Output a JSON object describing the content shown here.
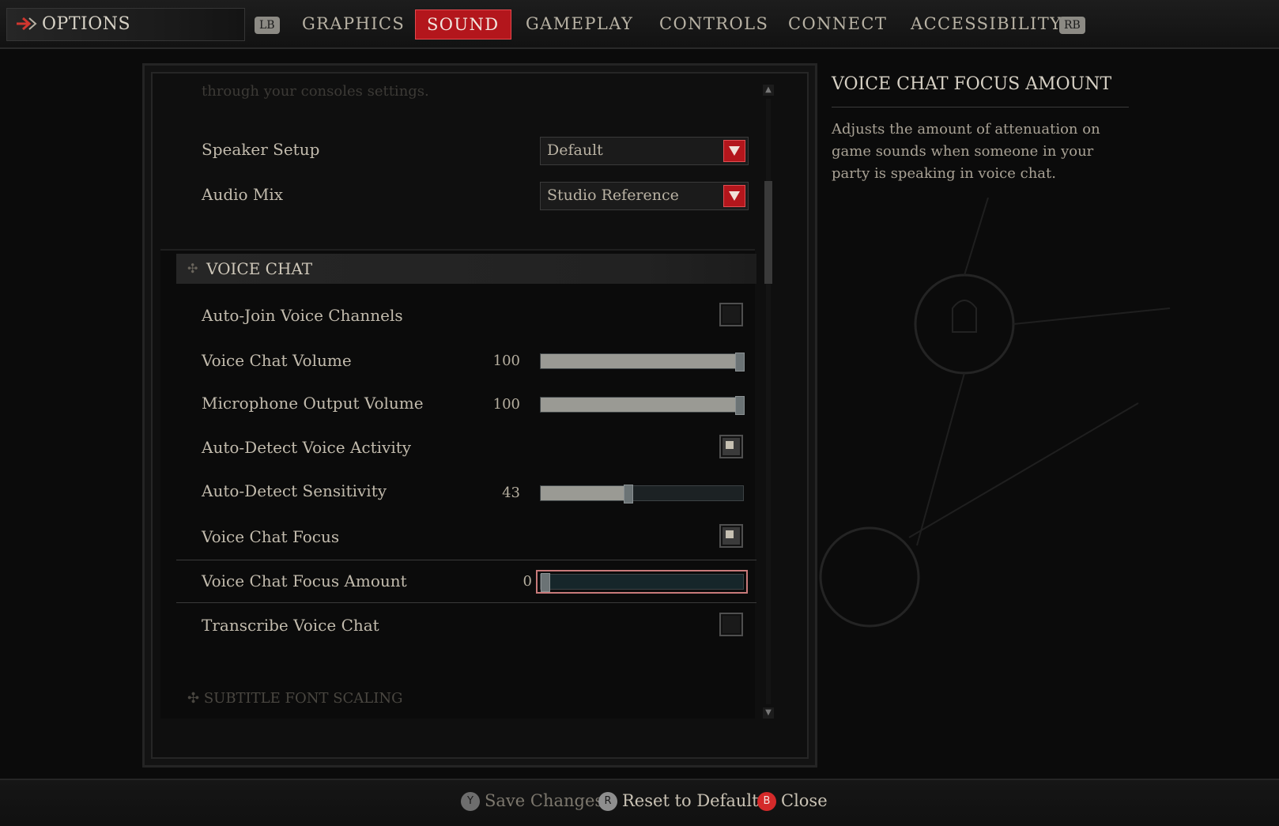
{
  "nav": {
    "options_label": "OPTIONS",
    "lb": "LB",
    "rb": "RB",
    "tabs": [
      {
        "label": "GRAPHICS"
      },
      {
        "label": "SOUND",
        "active": true
      },
      {
        "label": "GAMEPLAY"
      },
      {
        "label": "CONTROLS"
      },
      {
        "label": "CONNECT"
      },
      {
        "label": "ACCESSIBILITY"
      }
    ]
  },
  "settings": {
    "faded_top_text": "through your consoles settings.",
    "speaker_setup": {
      "label": "Speaker Setup",
      "value": "Default"
    },
    "audio_mix": {
      "label": "Audio Mix",
      "value": "Studio Reference"
    },
    "voice_chat_header": "VOICE CHAT",
    "auto_join": {
      "label": "Auto-Join Voice Channels",
      "checked": false
    },
    "voice_chat_volume": {
      "label": "Voice Chat Volume",
      "value": "100",
      "level": 100
    },
    "mic_output_volume": {
      "label": "Microphone Output Volume",
      "value": "100",
      "level": 100
    },
    "auto_detect_activity": {
      "label": "Auto-Detect Voice Activity",
      "checked": true
    },
    "auto_detect_sensitivity": {
      "label": "Auto-Detect Sensitivity",
      "value": "43",
      "level": 43
    },
    "voice_chat_focus": {
      "label": "Voice Chat Focus",
      "checked": true
    },
    "voice_chat_focus_amount": {
      "label": "Voice Chat Focus Amount",
      "value": "0",
      "level": 0
    },
    "transcribe": {
      "label": "Transcribe Voice Chat",
      "checked": false
    },
    "next_section": "SUBTITLE FONT SCALING"
  },
  "description": {
    "title": "VOICE CHAT FOCUS AMOUNT",
    "text": "Adjusts the amount of attenuation on game sounds when someone in your party is speaking in voice chat."
  },
  "footer": {
    "save": {
      "glyph": "Y",
      "label": "Save Changes"
    },
    "reset": {
      "glyph": "R",
      "label": "Reset to Defaults"
    },
    "close": {
      "glyph": "B",
      "label": "Close"
    }
  },
  "colors": {
    "accent": "#b3161c",
    "text": "#c2bbad",
    "background": "#0b0b0b"
  }
}
